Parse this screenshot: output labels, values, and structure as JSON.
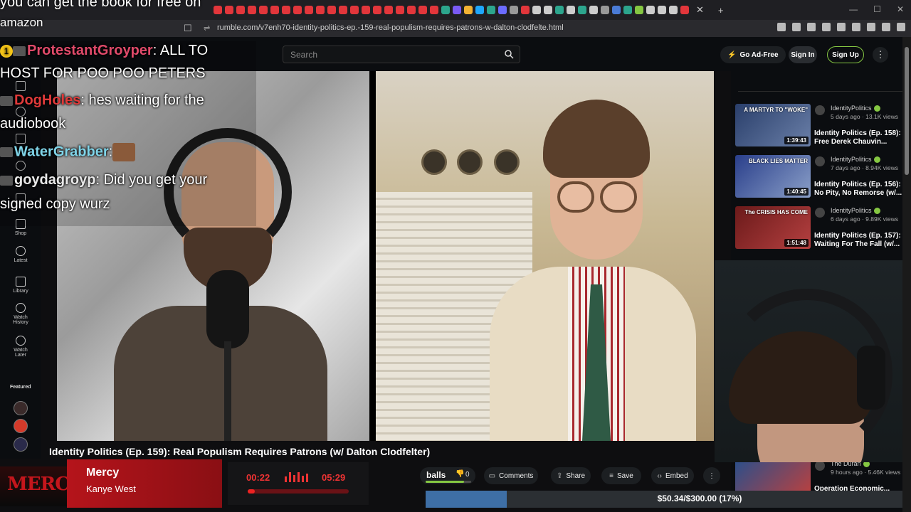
{
  "overlay": {
    "top_text": "you can get the book for free on",
    "amazon_text": "amazon"
  },
  "browser": {
    "url": "rumble.com/v7enh70-identity-politics-ep.-159-real-populism-requires-patrons-w-dalton-clodfelte.html",
    "close_tab": "✕",
    "new_tab": "+"
  },
  "header": {
    "search_placeholder": "Search",
    "go_ad_free": "Go Ad-Free",
    "sign_in": "Sign In",
    "sign_up": "Sign Up",
    "more": "⋮"
  },
  "sidebar": {
    "items": [
      {
        "label": "Shop"
      },
      {
        "label": "Latest"
      },
      {
        "label": "Library"
      },
      {
        "label": "Watch History"
      },
      {
        "label": "Watch Later"
      }
    ],
    "featured_label": "Featured"
  },
  "chat": {
    "messages": [
      {
        "user": "ProtestantGroyper",
        "text": ": ALL TO",
        "color": "#e04a6a"
      },
      {
        "user": "",
        "text": "HOST FOR POO POO PETERS",
        "color": "#ffffff"
      },
      {
        "user": "DogHoles",
        "text": ": hes waiting for the",
        "color": "#e03a3a"
      },
      {
        "user": "",
        "text": "audiobook",
        "color": "#ffffff"
      },
      {
        "user": "WaterGrabber",
        "text": ":",
        "color": "#7fd4e8"
      },
      {
        "user": "goydagroyp",
        "text": ": Did you get your",
        "color": "#e8e8e8"
      },
      {
        "user": "",
        "text": "signed copy wurz",
        "color": "#ffffff"
      }
    ],
    "badge": "1"
  },
  "related": [
    {
      "channel": "IdentityPolitics",
      "ago": "5 days ago",
      "views": "13.1K views",
      "title": "Identity Politics (Ep. 158): Free Derek Chauvin...",
      "duration": "1:39:43",
      "thumb_text": "A MARTYR TO \"WOKE\""
    },
    {
      "channel": "IdentityPolitics",
      "ago": "7 days ago",
      "views": "8.94K views",
      "title": "Identity Politics (Ep. 156): No Pity, No Remorse (w/...",
      "duration": "1:40:45",
      "thumb_text": "BLACK LIES MATTER"
    },
    {
      "channel": "IdentityPolitics",
      "ago": "6 days ago",
      "views": "9.89K views",
      "title": "Identity Politics (Ep. 157): Waiting For The Fall (w/...",
      "duration": "1:51:48",
      "thumb_text": "The CRISIS HAS COME"
    },
    {
      "channel": "The Duran",
      "ago": "9 hours ago",
      "views": "5.46K views",
      "title": "Operation Economic...",
      "duration": "",
      "thumb_text": ""
    }
  ],
  "video": {
    "title": "Identity Politics (Ep. 159): Real Populism Requires Patrons (w/ Dalton Clodfelter)"
  },
  "actions": {
    "vote_label": "balls",
    "dislike_count": "0",
    "vote_ratio": 0.85,
    "comments": "Comments",
    "share": "Share",
    "save": "Save",
    "embed": "Embed",
    "more": "⋮"
  },
  "music": {
    "logo": "MERCY",
    "song": "Mercy",
    "artist": "Kanye West",
    "time_current": "00:22",
    "time_total": "05:29",
    "progress": 0.067
  },
  "goal": {
    "text": "$50.34/$300.00 (17%)",
    "fraction": 0.1678
  },
  "colors": {
    "rumble_green": "#85c742",
    "music_red": "#b5141b",
    "goal_blue": "#3e6fa6"
  }
}
